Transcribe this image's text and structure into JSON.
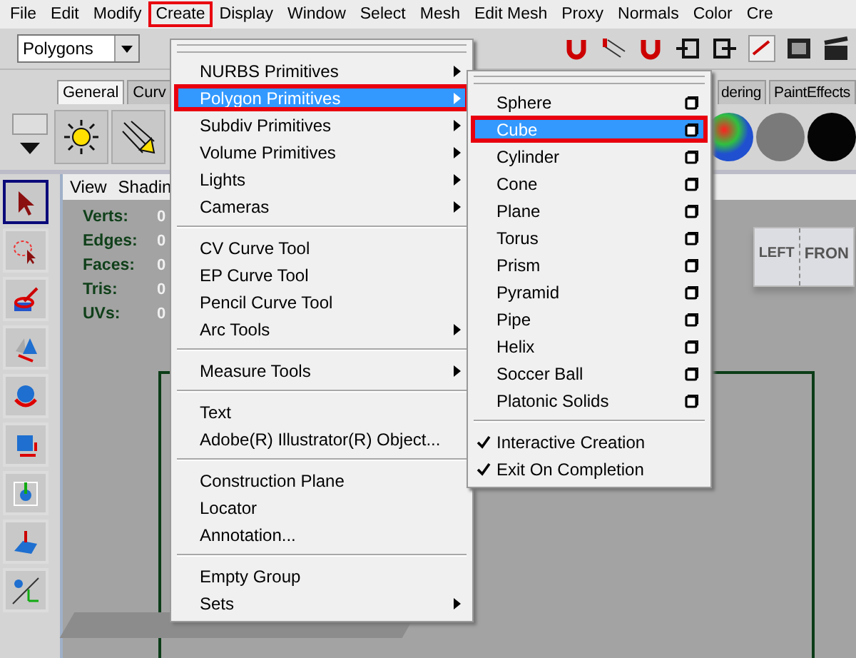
{
  "menubar": [
    {
      "label": "File",
      "selected": false
    },
    {
      "label": "Edit",
      "selected": false
    },
    {
      "label": "Modify",
      "selected": false
    },
    {
      "label": "Create",
      "selected": true
    },
    {
      "label": "Display",
      "selected": false
    },
    {
      "label": "Window",
      "selected": false
    },
    {
      "label": "Select",
      "selected": false
    },
    {
      "label": "Mesh",
      "selected": false
    },
    {
      "label": "Edit Mesh",
      "selected": false
    },
    {
      "label": "Proxy",
      "selected": false
    },
    {
      "label": "Normals",
      "selected": false
    },
    {
      "label": "Color",
      "selected": false
    },
    {
      "label": "Cre",
      "selected": false
    }
  ],
  "toolbar": {
    "mode_dropdown": "Polygons"
  },
  "shelf": {
    "tabs": [
      {
        "label": "General",
        "selected": true
      },
      {
        "label": "Curv",
        "selected": false
      },
      {
        "label": "dering",
        "selected": false
      },
      {
        "label": "PaintEffects",
        "selected": false
      }
    ]
  },
  "toolbox": [
    {
      "kind": "select",
      "selected": true
    },
    {
      "kind": "lasso",
      "selected": false
    },
    {
      "kind": "paint",
      "selected": false
    },
    {
      "kind": "move",
      "selected": false
    },
    {
      "kind": "rotate",
      "selected": false
    },
    {
      "kind": "scale",
      "selected": false
    },
    {
      "kind": "manipulator",
      "selected": false
    },
    {
      "kind": "softmod",
      "selected": false
    },
    {
      "kind": "last",
      "selected": false
    }
  ],
  "viewport": {
    "panel_menu": [
      "View",
      "Shadin"
    ],
    "hud": [
      {
        "label": "Verts:",
        "value": "0"
      },
      {
        "label": "Edges:",
        "value": "0"
      },
      {
        "label": "Faces:",
        "value": "0"
      },
      {
        "label": "Tris:",
        "value": "0"
      },
      {
        "label": "UVs:",
        "value": "0"
      }
    ],
    "view_cube": {
      "left": "LEFT",
      "front": "FRON"
    }
  },
  "create_menu": {
    "sections": [
      [
        {
          "label": "NURBS Primitives",
          "submenu": true,
          "selected": false
        },
        {
          "label": "Polygon Primitives",
          "submenu": true,
          "selected": true
        },
        {
          "label": "Subdiv Primitives",
          "submenu": true,
          "selected": false
        },
        {
          "label": "Volume Primitives",
          "submenu": true,
          "selected": false
        },
        {
          "label": "Lights",
          "submenu": true,
          "selected": false
        },
        {
          "label": "Cameras",
          "submenu": true,
          "selected": false
        }
      ],
      [
        {
          "label": "CV Curve Tool",
          "submenu": false,
          "selected": false
        },
        {
          "label": "EP Curve Tool",
          "submenu": false,
          "selected": false
        },
        {
          "label": "Pencil Curve Tool",
          "submenu": false,
          "selected": false
        },
        {
          "label": "Arc Tools",
          "submenu": true,
          "selected": false
        }
      ],
      [
        {
          "label": "Measure Tools",
          "submenu": true,
          "selected": false
        }
      ],
      [
        {
          "label": "Text",
          "submenu": false,
          "selected": false
        },
        {
          "label": "Adobe(R) Illustrator(R) Object...",
          "submenu": false,
          "selected": false
        }
      ],
      [
        {
          "label": "Construction Plane",
          "submenu": false,
          "selected": false
        },
        {
          "label": "Locator",
          "submenu": false,
          "selected": false
        },
        {
          "label": "Annotation...",
          "submenu": false,
          "selected": false
        }
      ],
      [
        {
          "label": "Empty Group",
          "submenu": false,
          "selected": false
        },
        {
          "label": "Sets",
          "submenu": true,
          "selected": false
        }
      ]
    ]
  },
  "polygon_submenu": {
    "items": [
      {
        "label": "Sphere",
        "selected": false
      },
      {
        "label": "Cube",
        "selected": true
      },
      {
        "label": "Cylinder",
        "selected": false
      },
      {
        "label": "Cone",
        "selected": false
      },
      {
        "label": "Plane",
        "selected": false
      },
      {
        "label": "Torus",
        "selected": false
      },
      {
        "label": "Prism",
        "selected": false
      },
      {
        "label": "Pyramid",
        "selected": false
      },
      {
        "label": "Pipe",
        "selected": false
      },
      {
        "label": "Helix",
        "selected": false
      },
      {
        "label": "Soccer Ball",
        "selected": false
      },
      {
        "label": "Platonic Solids",
        "selected": false
      }
    ],
    "toggles": [
      {
        "label": "Interactive Creation",
        "checked": true
      },
      {
        "label": "Exit On Completion",
        "checked": true
      }
    ]
  }
}
